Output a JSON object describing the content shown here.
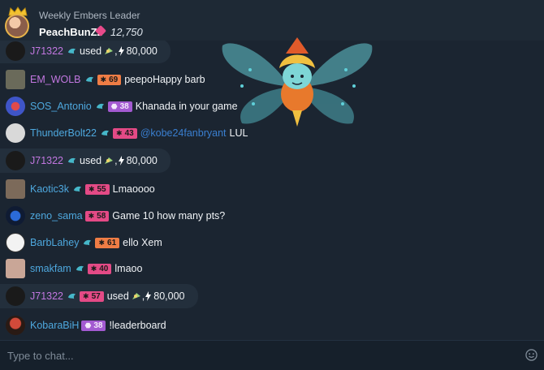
{
  "leader": {
    "title": "Weekly Embers Leader",
    "name": "PeachBunZz",
    "score": "12,750"
  },
  "messages": [
    {
      "user": "J71322",
      "pre": "used",
      "count": "80,000",
      "color": "purple"
    },
    {
      "user": "EM_WOLB",
      "level": "69",
      "text": "peepoHappy barb",
      "color": "purple"
    },
    {
      "user": "SOS_Antonio",
      "level": "38",
      "text": "Khanada in your game",
      "color": "blue"
    },
    {
      "user": "ThunderBolt22",
      "level": "43",
      "mention": "@kobe24fanbryant",
      "text": "LUL",
      "color": "blue"
    },
    {
      "user": "J71322",
      "pre": "used",
      "count": "80,000",
      "color": "purple"
    },
    {
      "user": "Kaotic3k",
      "level": "55",
      "text": "Lmaoooo",
      "color": "blue"
    },
    {
      "user": "zeno_sama",
      "level": "58",
      "text": "Game 10 how many pts?",
      "color": "blue"
    },
    {
      "user": "BarbLahey",
      "level": "61",
      "text": "ello Xem",
      "color": "blue"
    },
    {
      "user": "smakfam",
      "level": "40",
      "text": "lmaoo",
      "color": "blue"
    },
    {
      "user": "J71322",
      "level": "57",
      "pre": "used",
      "count": "80,000",
      "color": "purple"
    },
    {
      "user": "KobaraBiH",
      "level": "38",
      "text": "!leaderboard",
      "color": "blue"
    }
  ],
  "input": {
    "placeholder": "Type to chat..."
  },
  "icons": {
    "crown": "crown-icon",
    "ember": "ember-gem-icon",
    "emoji": "emoji-icon",
    "fairy": "fairy-emote"
  }
}
